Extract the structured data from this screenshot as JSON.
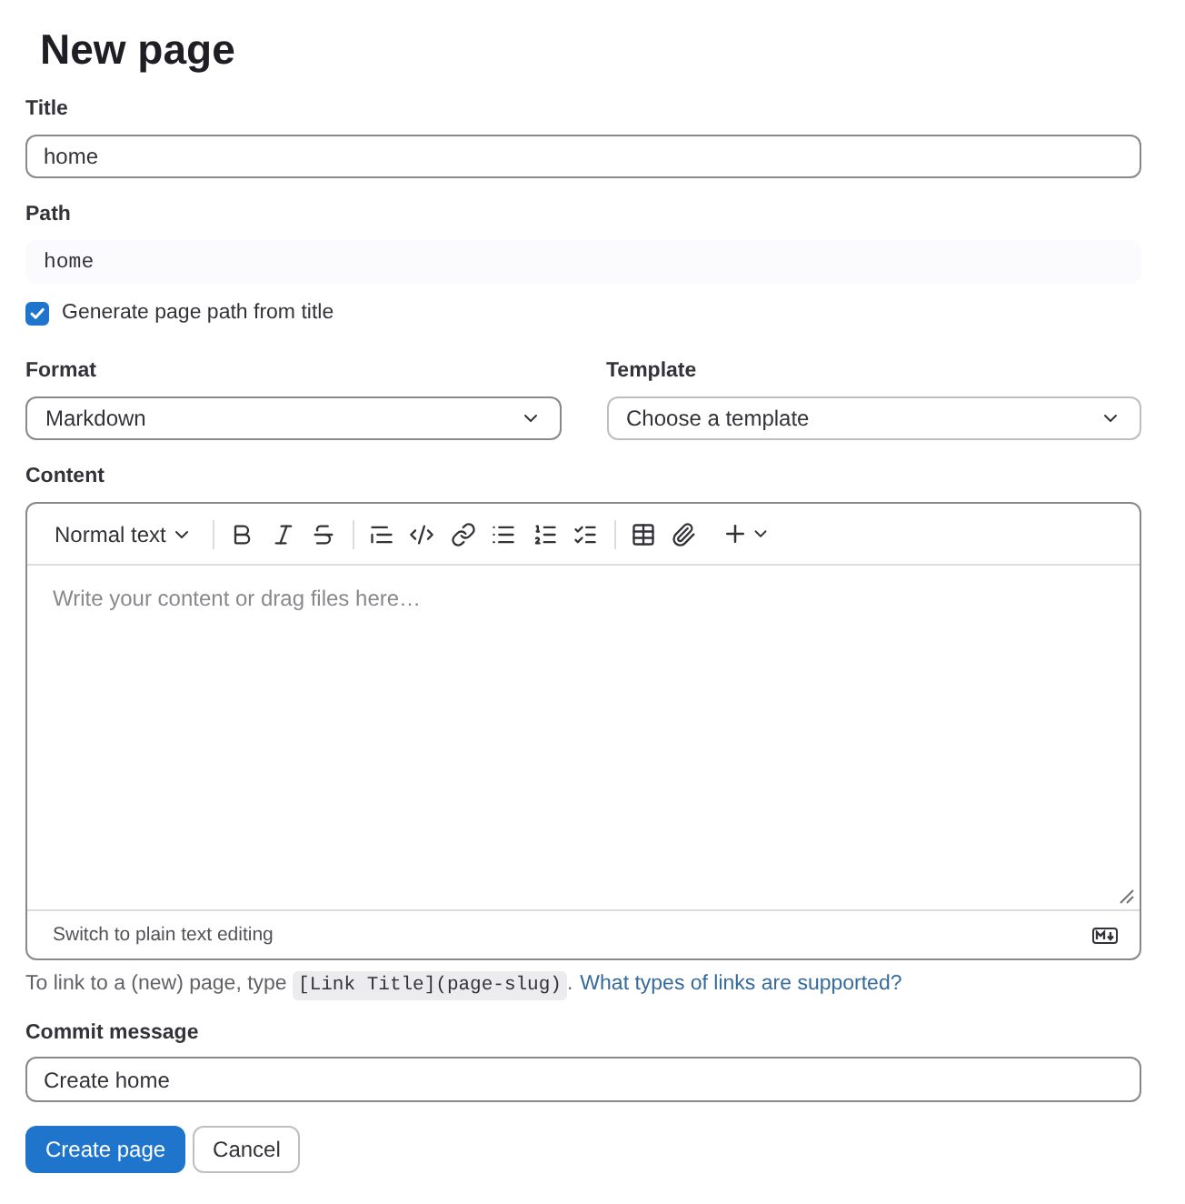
{
  "page_title": "New page",
  "title_field": {
    "label": "Title",
    "value": "home"
  },
  "path_field": {
    "label": "Path",
    "value": "home"
  },
  "generate_path": {
    "label": "Generate page path from title",
    "checked": true
  },
  "selects": [
    {
      "kind": "select",
      "label": "Format",
      "value": "Markdown"
    },
    {
      "kind": "dropdown",
      "label": "Template",
      "value": "Choose a template"
    }
  ],
  "content": {
    "label": "Content",
    "text_style": "Normal text",
    "placeholder": "Write your content or drag files here…",
    "switch_link": "Switch to plain text editing"
  },
  "help": {
    "text_before": "To link to a (new) page, type ",
    "code": "[Link Title](page-slug)",
    "text_after": ".",
    "link": "What types of links are supported?"
  },
  "commit_field": {
    "label": "Commit message",
    "value": "Create home"
  },
  "buttons": [
    {
      "kind": "primary",
      "label": "Create page"
    },
    {
      "kind": "secondary",
      "label": "Cancel"
    }
  ]
}
